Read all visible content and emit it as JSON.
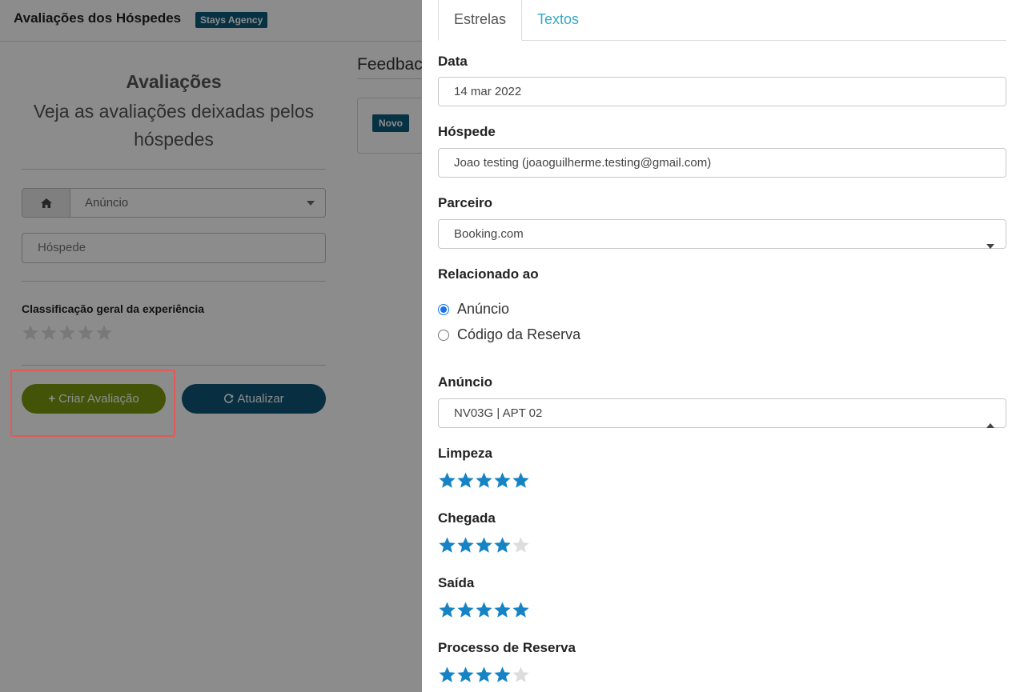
{
  "header": {
    "title": "Avaliações dos Hóspedes",
    "badge": "Stays Agency"
  },
  "left_panel": {
    "title": "Avaliações",
    "subtitle": "Veja as avaliações deixadas pelos hóspedes",
    "listing_select": {
      "icon": "home-icon",
      "value": "Anúncio"
    },
    "guest_input": {
      "placeholder": "Hóspede"
    },
    "rating_label": "Classificação geral da experiência",
    "rating_value": 0,
    "create_button": "Criar Avaliação",
    "refresh_button": "Atualizar"
  },
  "feedback": {
    "title": "Feedbac",
    "badge": "Novo"
  },
  "drawer": {
    "tabs": [
      {
        "label": "Estrelas",
        "active": true
      },
      {
        "label": "Textos",
        "active": false
      }
    ],
    "date": {
      "label": "Data",
      "value": "14 mar 2022"
    },
    "guest": {
      "label": "Hóspede",
      "value": "Joao testing (joaoguilherme.testing@gmail.com)"
    },
    "partner": {
      "label": "Parceiro",
      "value": "Booking.com"
    },
    "related": {
      "label": "Relacionado ao",
      "options": [
        {
          "label": "Anúncio",
          "checked": true
        },
        {
          "label": "Código da Reserva",
          "checked": false
        }
      ]
    },
    "listing": {
      "label": "Anúncio",
      "value": "NV03G | APT 02"
    },
    "ratings": [
      {
        "label": "Limpeza",
        "value": 5
      },
      {
        "label": "Chegada",
        "value": 4
      },
      {
        "label": "Saída",
        "value": 5
      },
      {
        "label": "Processo de Reserva",
        "value": 4
      }
    ]
  },
  "colors": {
    "star_filled": "#1583c4",
    "star_empty": "#dddddd",
    "create_button": "#7a9a12",
    "refresh_button": "#0d5677",
    "tab_link": "#35a9c6",
    "badge": "#0e5b7d"
  }
}
